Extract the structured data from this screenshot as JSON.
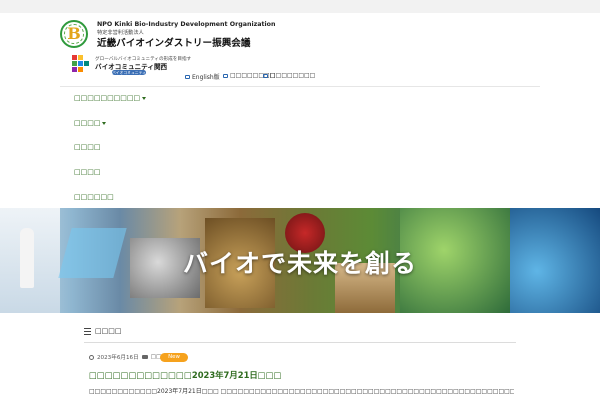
{
  "header": {
    "org_name_en": "NPO Kinki Bio-Industry Development Organization",
    "org_type": "特定非営利活動法人",
    "org_name_ja": "近畿バイオインダストリー振興会議",
    "community_subtitle": "グローバルバイオコミュニティの形成を目指す",
    "community_name": "バイオコミュニティ関西",
    "community_badge": "バイオコミュニティ関西",
    "util_links": [
      {
        "label": "English版"
      },
      {
        "label": "□□□□□□□□"
      },
      {
        "label": "□□□□□□□□"
      }
    ]
  },
  "nav": {
    "items": [
      {
        "label": "□□□□□□□□□□",
        "has_submenu": true
      },
      {
        "label": "□□□□",
        "has_submenu": true
      },
      {
        "label": "□□□□",
        "has_submenu": false
      },
      {
        "label": "□□□□",
        "has_submenu": false
      },
      {
        "label": "□□□□□□",
        "has_submenu": false
      }
    ]
  },
  "hero": {
    "title": "バイオで未来を創る"
  },
  "news": {
    "section_title": "□□□□",
    "items": [
      {
        "date": "2023年6月16日",
        "category": "□□□□",
        "badge": "New",
        "title": "□□□□□□□□□□□□□2023年7月21日□□□",
        "body": "□□□□□□□□□□□□2023年7月21日□□□ □□□□□□□□□□□□□□□□□□□□□□□□□□□□□□□□□□□□□□□□□□□□□□□□□□□□□□□□□□□□□□□□□□□□□□□□□□□□□□□□□□□□□"
      }
    ]
  },
  "colors": {
    "nav_text": "#2e6b1e",
    "badge_new": "#f6a21d",
    "link_icon": "#2a67b0"
  }
}
